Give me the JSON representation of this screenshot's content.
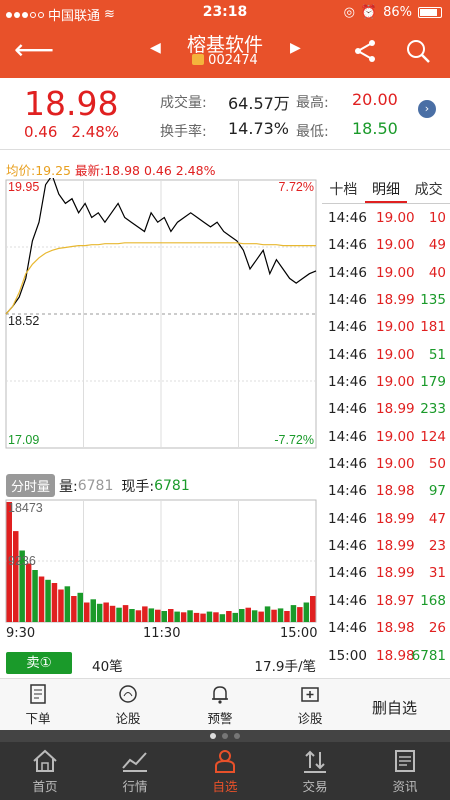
{
  "statusbar": {
    "carrier": "中国联通",
    "time": "23:18",
    "battery": "86%"
  },
  "header": {
    "name": "榕基软件",
    "code": "002474"
  },
  "quote": {
    "price": "18.98",
    "change": "0.46",
    "change_pct": "2.48%",
    "volume_label": "成交量:",
    "volume": "64.57万",
    "turnover_label": "换手率:",
    "turnover": "14.73%",
    "high_label": "最高:",
    "high": "20.00",
    "low_label": "最低:",
    "low": "18.50"
  },
  "chart_header": {
    "avg": "均价:19.25",
    "latest": "最新:18.98 0.46 2.48%"
  },
  "chart_data": {
    "type": "line",
    "series": [
      {
        "values": [
          18.52,
          18.6,
          18.7,
          18.9,
          19.3,
          19.5,
          19.9,
          20.0,
          19.8,
          19.7,
          19.75,
          19.6,
          19.7,
          19.55,
          19.6,
          19.5,
          19.6,
          19.7,
          19.55,
          19.5,
          19.45,
          19.4,
          19.6,
          19.5,
          19.55,
          19.4,
          19.5,
          19.55,
          19.6,
          19.55,
          19.5,
          19.45,
          19.5,
          19.4,
          19.35,
          19.3,
          19.2,
          19.0,
          19.1,
          19.2,
          18.95,
          19.1,
          19.0,
          18.9,
          18.85,
          18.9,
          18.95,
          18.98
        ]
      },
      {
        "values": [
          18.52,
          18.6,
          18.75,
          18.95,
          19.05,
          19.12,
          19.17,
          19.2,
          19.22,
          19.23,
          19.24,
          19.25,
          19.25,
          19.26,
          19.26,
          19.27,
          19.27,
          19.27,
          19.28,
          19.28,
          19.28,
          19.28,
          19.28,
          19.28,
          19.28,
          19.28,
          19.28,
          19.28,
          19.28,
          19.28,
          19.28,
          19.28,
          19.28,
          19.28,
          19.28,
          19.28,
          19.27,
          19.27,
          19.27,
          19.26,
          19.26,
          19.26,
          19.25,
          19.25,
          19.25,
          19.25,
          19.25,
          19.25
        ]
      }
    ],
    "ylim": [
      17.09,
      19.95
    ],
    "yticks": {
      "top": "19.95",
      "mid": "18.52",
      "bottom": "17.09"
    },
    "pct": {
      "top": "7.72%",
      "bottom": "-7.72%"
    },
    "volume": {
      "max_label": "18473",
      "mid_label": "9236",
      "values": [
        18473,
        14000,
        11000,
        9000,
        8000,
        7000,
        6500,
        6000,
        5000,
        5500,
        4000,
        4500,
        3000,
        3500,
        2800,
        3000,
        2500,
        2200,
        2600,
        2000,
        1800,
        2400,
        2100,
        1900,
        1700,
        2000,
        1600,
        1500,
        1800,
        1400,
        1300,
        1600,
        1500,
        1200,
        1700,
        1400,
        2000,
        2200,
        1800,
        1600,
        2400,
        1900,
        2100,
        1700,
        2600,
        2300,
        3000,
        4000
      ],
      "colors": [
        "red",
        "red",
        "green",
        "red",
        "green",
        "red",
        "green",
        "red",
        "red",
        "green",
        "red",
        "green",
        "red",
        "green",
        "green",
        "red",
        "red",
        "green",
        "red",
        "green",
        "red",
        "red",
        "green",
        "red",
        "green",
        "red",
        "green",
        "red",
        "green",
        "red",
        "red",
        "green",
        "red",
        "green",
        "red",
        "green",
        "green",
        "red",
        "green",
        "red",
        "green",
        "red",
        "green",
        "red",
        "green",
        "red",
        "green",
        "red"
      ]
    },
    "xticks": [
      "9:30",
      "11:30",
      "15:00"
    ],
    "colors": {
      "price": "#000000",
      "avg": "#e8b830",
      "up": "#e02020",
      "down": "#1a9a2a"
    }
  },
  "volume_bar": {
    "button": "分时量",
    "vol_label": "量:",
    "vol_value": "6781",
    "hand_label": "现手:",
    "hand_value": "6781"
  },
  "sell": {
    "button": "卖①",
    "count": "40笔",
    "hand": "17.9手/笔"
  },
  "tabs": [
    "十档",
    "明细",
    "成交"
  ],
  "trades": [
    {
      "time": "14:46",
      "price": "19.00",
      "qty": "10",
      "pc": "red",
      "qc": "red"
    },
    {
      "time": "14:46",
      "price": "19.00",
      "qty": "49",
      "pc": "red",
      "qc": "red"
    },
    {
      "time": "14:46",
      "price": "19.00",
      "qty": "40",
      "pc": "red",
      "qc": "red"
    },
    {
      "time": "14:46",
      "price": "18.99",
      "qty": "135",
      "pc": "red",
      "qc": "green"
    },
    {
      "time": "14:46",
      "price": "19.00",
      "qty": "181",
      "pc": "red",
      "qc": "red"
    },
    {
      "time": "14:46",
      "price": "19.00",
      "qty": "51",
      "pc": "red",
      "qc": "green"
    },
    {
      "time": "14:46",
      "price": "19.00",
      "qty": "179",
      "pc": "red",
      "qc": "green"
    },
    {
      "time": "14:46",
      "price": "18.99",
      "qty": "233",
      "pc": "red",
      "qc": "green"
    },
    {
      "time": "14:46",
      "price": "19.00",
      "qty": "124",
      "pc": "red",
      "qc": "red"
    },
    {
      "time": "14:46",
      "price": "19.00",
      "qty": "50",
      "pc": "red",
      "qc": "red"
    },
    {
      "time": "14:46",
      "price": "18.98",
      "qty": "97",
      "pc": "red",
      "qc": "green"
    },
    {
      "time": "14:46",
      "price": "18.99",
      "qty": "47",
      "pc": "red",
      "qc": "red"
    },
    {
      "time": "14:46",
      "price": "18.99",
      "qty": "23",
      "pc": "red",
      "qc": "red"
    },
    {
      "time": "14:46",
      "price": "18.99",
      "qty": "31",
      "pc": "red",
      "qc": "red"
    },
    {
      "time": "14:46",
      "price": "18.97",
      "qty": "168",
      "pc": "red",
      "qc": "green"
    },
    {
      "time": "14:46",
      "price": "18.98",
      "qty": "26",
      "pc": "red",
      "qc": "red"
    },
    {
      "time": "15:00",
      "price": "18.98",
      "qty": "6781",
      "pc": "red",
      "qc": "green"
    }
  ],
  "actions": {
    "order": "下单",
    "discuss": "论股",
    "alert": "预警",
    "diagnose": "诊股",
    "remove_fav": "删自选"
  },
  "bottom_nav": [
    "首页",
    "行情",
    "自选",
    "交易",
    "资讯"
  ]
}
